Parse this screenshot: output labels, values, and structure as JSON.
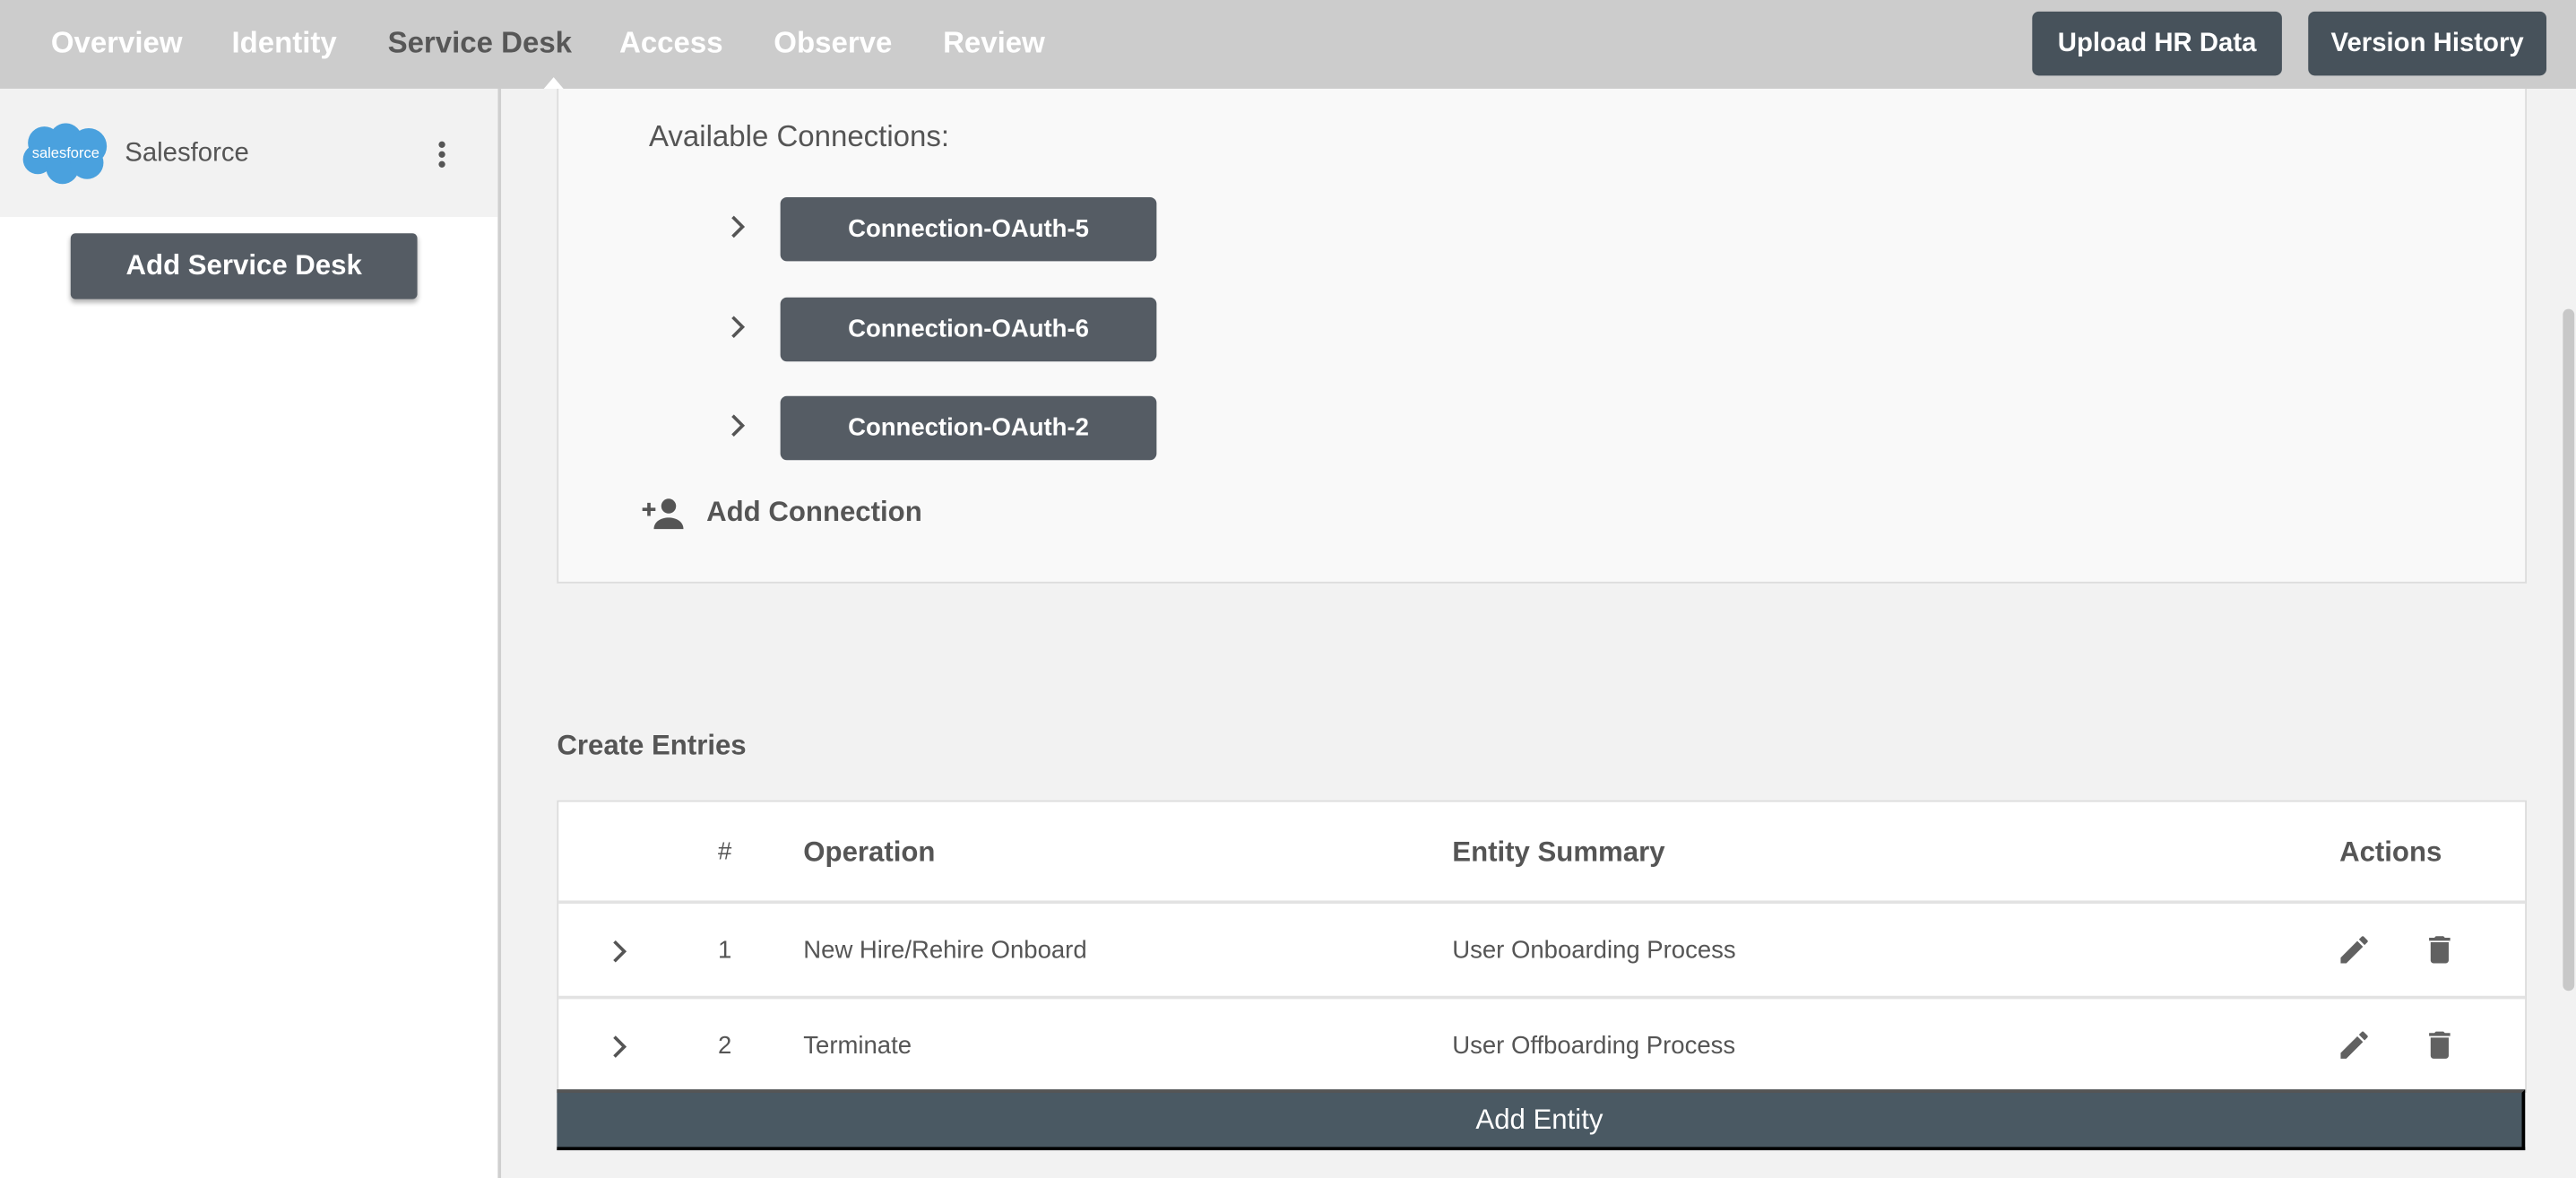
{
  "nav": {
    "tabs": [
      {
        "label": "Overview"
      },
      {
        "label": "Identity"
      },
      {
        "label": "Service Desk",
        "active": true
      },
      {
        "label": "Access"
      },
      {
        "label": "Observe"
      },
      {
        "label": "Review"
      }
    ],
    "upload_label": "Upload HR Data",
    "version_label": "Version History"
  },
  "sidebar": {
    "item_label": "Salesforce",
    "logo_text": "salesforce",
    "add_label": "Add Service Desk"
  },
  "connections": {
    "heading": "Available Connections:",
    "items": [
      "Connection-OAuth-5",
      "Connection-OAuth-6",
      "Connection-OAuth-2"
    ],
    "add_label": "Add Connection"
  },
  "entries": {
    "title": "Create Entries",
    "headers": {
      "num": "#",
      "operation": "Operation",
      "summary": "Entity Summary",
      "actions": "Actions"
    },
    "rows": [
      {
        "num": "1",
        "operation": "New Hire/Rehire Onboard",
        "summary": "User Onboarding Process"
      },
      {
        "num": "2",
        "operation": "Terminate",
        "summary": "User Offboarding Process"
      }
    ],
    "add_label": "Add Entity"
  },
  "colors": {
    "topbar": "#cccccc",
    "button": "#555c64",
    "add_entity": "#4a5963",
    "salesforce": "#4aa1de"
  }
}
